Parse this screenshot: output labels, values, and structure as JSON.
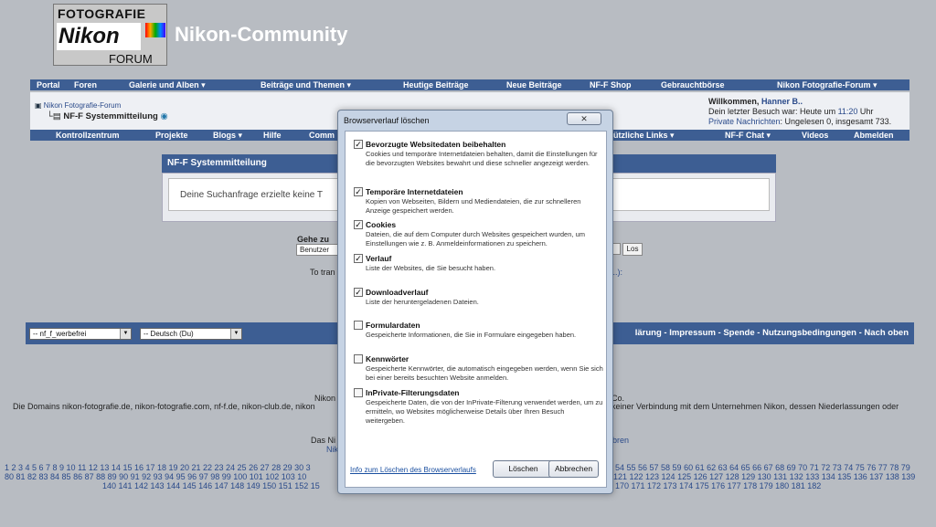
{
  "header": {
    "logo": [
      "FOTOGRAFIE",
      "Nikon",
      "FORUM"
    ],
    "site_title": "Nikon-Community"
  },
  "nav1": [
    "Portal",
    "Foren",
    "Galerie und Alben ▾",
    "Beiträge und Themen ▾",
    "Heutige Beiträge",
    "Neue Beiträge",
    "NF-F Shop",
    "Gebrauchtbörse",
    "Nikon Fotografie-Forum ▾"
  ],
  "crumb": {
    "root": "Nikon Fotografie-Forum",
    "current": "NF-F Systemmitteilung"
  },
  "welcome": {
    "line1_prefix": "Willkommen, ",
    "user": "Hanner B..",
    "line2": "Dein letzter Besuch war: Heute um ",
    "time": "11:20",
    "line2_suffix": " Uhr",
    "line3_link": "Private Nachrichten",
    "line3": ": Ungelesen 0, insgesamt 733."
  },
  "nav2": [
    "Kontrollzentrum",
    "Projekte",
    "Blogs ▾",
    "Hilfe",
    "Comm",
    "ützliche Links ▾",
    "NF-F Chat ▾",
    "Videos",
    "Abmelden"
  ],
  "sysmsg": {
    "title": "NF-F Systemmitteilung",
    "text": "Deine Suchanfrage erzielte keine T"
  },
  "goto": {
    "label": "Gehe zu",
    "select": "Benutzer",
    "button": "Los",
    "totrans": "To tran",
    "totrans_right": "...):"
  },
  "footer": {
    "style_select": "-- nf_f_werbefrei",
    "lang_select": "-- Deutsch (Du)",
    "links": "lärung - Impressum - Spende - Nutzungsbedingungen - Nach oben",
    "disc1": "Nikon",
    "disc1r": "Co.",
    "disc2": "Die Domains nikon-fotografie.de, nikon-fotografie.com, nf-f.de, nikon-club.de, nikon",
    "disc2r": "keiner Verbindung mit dem Unternehmen Nikon, dessen Niederlassungen oder",
    "disc3": "Das Ni",
    "disc3b": "Nik",
    "disc3r": "bren"
  },
  "pages": {
    "row1_left": "1 2 3 4 5 6 7 8 9 10 11 12 13 14 15 16 17 18 19 20 21 22 23 24 25 26 27 28 29 30 3",
    "row1_right": "54 55 56 57 58 59 60 61 62 63 64 65 66 67 68 69 70 71 72 73 74 75 76 77 78 79",
    "row2_left": "80 81 82 83 84 85 86 87 88 89 90 91 92 93 94 95 96 97 98 99 100 101 102 103 10",
    "row2_right": "121 122 123 124 125 126 127 128 129 130 131 132 133 134 135 136 137 138 139",
    "row3_left": "140 141 142 143 144 145 146 147 148 149 150 151 152 15",
    "row3_right": "170 171 172 173 174 175 176 177 178 179 180 181 182"
  },
  "dialog": {
    "title": "Browserverlauf löschen",
    "close": "✕",
    "options": [
      {
        "checked": true,
        "title": "Bevorzugte Websitedaten beibehalten",
        "desc": "Cookies und temporäre Internetdateien behalten, damit die Einstellungen für die bevorzugten Websites bewahrt und diese schneller angezeigt werden."
      },
      {
        "checked": true,
        "title": "Temporäre Internetdateien",
        "desc": "Kopien von Webseiten, Bildern und Mediendateien, die zur schnelleren Anzeige gespeichert werden."
      },
      {
        "checked": true,
        "title": "Cookies",
        "desc": "Dateien, die auf dem Computer durch Websites gespeichert wurden, um Einstellungen wie z. B. Anmeldeinformationen zu speichern."
      },
      {
        "checked": true,
        "title": "Verlauf",
        "desc": "Liste der Websites, die Sie besucht haben."
      },
      {
        "checked": true,
        "title": "Downloadverlauf",
        "desc": "Liste der heruntergeladenen Dateien."
      },
      {
        "checked": false,
        "title": "Formulardaten",
        "desc": "Gespeicherte Informationen, die Sie in Formulare eingegeben haben."
      },
      {
        "checked": false,
        "title": "Kennwörter",
        "desc": "Gespeicherte Kennwörter, die automatisch eingegeben werden, wenn Sie sich bei einer bereits besuchten Website anmelden."
      },
      {
        "checked": false,
        "title": "InPrivate-Filterungsdaten",
        "desc": "Gespeicherte Daten, die von der InPrivate-Filterung verwendet werden, um zu ermitteln, wo Websites möglicherweise Details über Ihren Besuch weitergeben."
      }
    ],
    "info_link": "Info zum Löschen des Browserverlaufs",
    "delete_button": "Löschen",
    "cancel_button": "Abbrechen"
  }
}
